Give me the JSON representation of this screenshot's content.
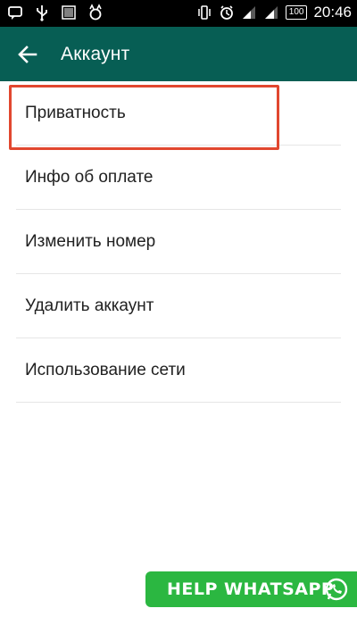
{
  "status_bar": {
    "icons_left": [
      "message-icon",
      "usb-icon",
      "barcode-icon",
      "cat-icon"
    ],
    "icons_right": [
      "vibrate-icon",
      "alarm-icon",
      "signal-icon",
      "signal-icon"
    ],
    "battery_label": "100",
    "time": "20:46"
  },
  "header": {
    "back_icon": "arrow-left-icon",
    "title": "Аккаунт",
    "color": "#075e54"
  },
  "menu": {
    "items": [
      {
        "label": "Приватность",
        "highlighted": true
      },
      {
        "label": "Инфо об оплате"
      },
      {
        "label": "Изменить номер"
      },
      {
        "label": "Удалить аккаунт"
      },
      {
        "label": "Использование сети"
      }
    ]
  },
  "watermark": {
    "text": "HELP WHATSAPP",
    "icon": "whatsapp-logo-icon",
    "color": "#2bb741"
  },
  "accent": {
    "highlight_border": "#e1472f"
  }
}
